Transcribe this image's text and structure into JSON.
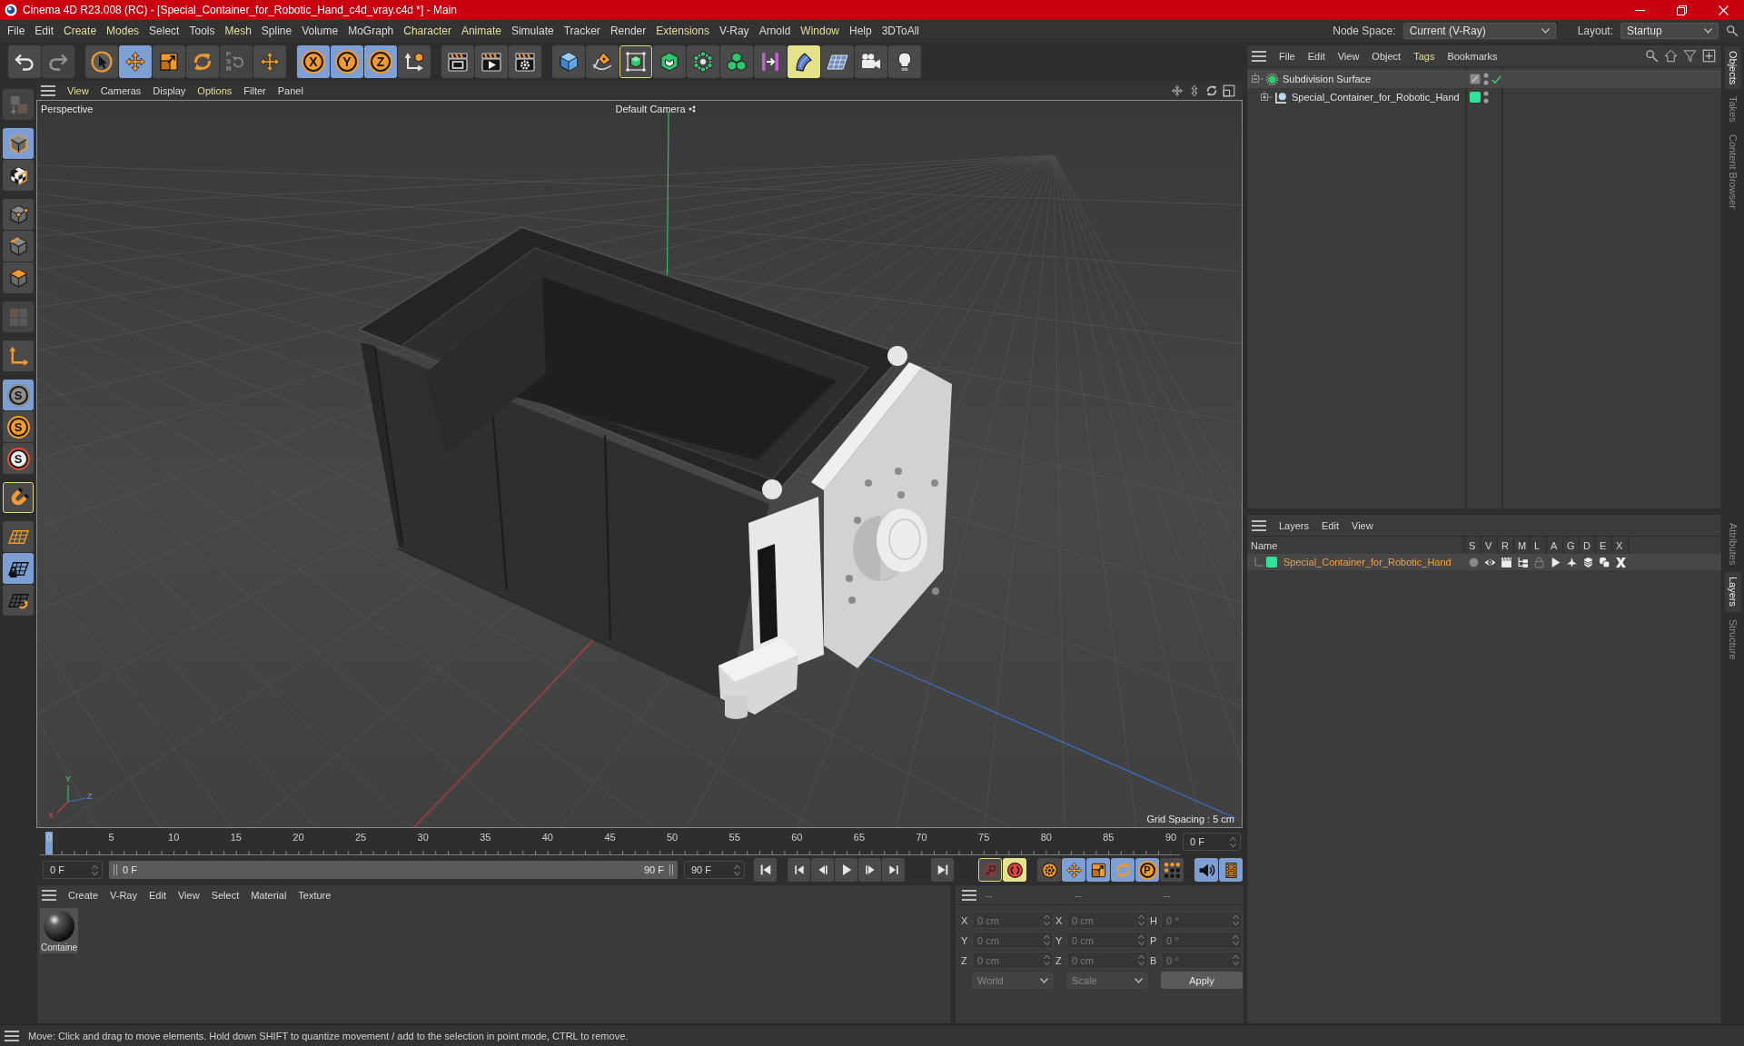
{
  "window": {
    "title": "Cinema 4D R23.008 (RC) - [Special_Container_for_Robotic_Hand_c4d_vray.c4d *] - Main"
  },
  "menu_bar": {
    "items": [
      {
        "label": "File",
        "highlighted": false
      },
      {
        "label": "Edit",
        "highlighted": false
      },
      {
        "label": "Create",
        "highlighted": true
      },
      {
        "label": "Modes",
        "highlighted": true
      },
      {
        "label": "Select",
        "highlighted": false
      },
      {
        "label": "Tools",
        "highlighted": false
      },
      {
        "label": "Mesh",
        "highlighted": true
      },
      {
        "label": "Spline",
        "highlighted": false
      },
      {
        "label": "Volume",
        "highlighted": false
      },
      {
        "label": "MoGraph",
        "highlighted": false
      },
      {
        "label": "Character",
        "highlighted": true
      },
      {
        "label": "Animate",
        "highlighted": true
      },
      {
        "label": "Simulate",
        "highlighted": false
      },
      {
        "label": "Tracker",
        "highlighted": false
      },
      {
        "label": "Render",
        "highlighted": false
      },
      {
        "label": "Extensions",
        "highlighted": true
      },
      {
        "label": "V-Ray",
        "highlighted": false
      },
      {
        "label": "Arnold",
        "highlighted": false
      },
      {
        "label": "Window",
        "highlighted": true
      },
      {
        "label": "Help",
        "highlighted": false
      },
      {
        "label": "3DToAll",
        "highlighted": false
      }
    ],
    "node_space": {
      "label": "Node Space:",
      "value": "Current (V-Ray)"
    },
    "layout": {
      "label": "Layout:",
      "value": "Startup"
    }
  },
  "toolbar": {
    "groups": [
      [
        {
          "kind": "undo",
          "selected": false,
          "disabled": false,
          "outlined": false,
          "lit": false
        },
        {
          "kind": "redo",
          "selected": false,
          "disabled": true,
          "outlined": false,
          "lit": false
        }
      ],
      [
        {
          "kind": "select",
          "selected": false,
          "disabled": false,
          "outlined": false,
          "lit": false
        },
        {
          "kind": "move",
          "selected": true,
          "disabled": false,
          "outlined": false,
          "lit": false
        },
        {
          "kind": "scale",
          "selected": false,
          "disabled": false,
          "outlined": false,
          "lit": false
        },
        {
          "kind": "rotate",
          "selected": false,
          "disabled": false,
          "outlined": false,
          "lit": false
        },
        {
          "kind": "psr",
          "selected": false,
          "disabled": true,
          "outlined": false,
          "lit": false,
          "label": "PSR"
        },
        {
          "kind": "axis_move",
          "selected": false,
          "disabled": false,
          "outlined": false,
          "lit": false
        }
      ],
      [
        {
          "kind": "axis_lock",
          "selected": true,
          "disabled": false,
          "outlined": false,
          "lit": false,
          "label": "X"
        },
        {
          "kind": "axis_lock",
          "selected": true,
          "disabled": false,
          "outlined": false,
          "lit": false,
          "label": "Y"
        },
        {
          "kind": "axis_lock",
          "selected": true,
          "disabled": false,
          "outlined": false,
          "lit": false,
          "label": "Z"
        },
        {
          "kind": "coordinate_system",
          "selected": false,
          "disabled": false,
          "outlined": false,
          "lit": false
        }
      ],
      [
        {
          "kind": "render_view",
          "selected": false,
          "disabled": false,
          "outlined": false,
          "lit": false
        },
        {
          "kind": "render_picture",
          "selected": false,
          "disabled": false,
          "outlined": false,
          "lit": false
        },
        {
          "kind": "render_settings",
          "selected": false,
          "disabled": false,
          "outlined": false,
          "lit": false
        }
      ],
      [
        {
          "kind": "cube",
          "selected": false,
          "disabled": false,
          "outlined": false,
          "lit": false
        },
        {
          "kind": "pen",
          "selected": false,
          "disabled": false,
          "outlined": false,
          "lit": false
        },
        {
          "kind": "cube_cage",
          "selected": false,
          "disabled": false,
          "outlined": true,
          "lit": false
        },
        {
          "kind": "cube_outline",
          "selected": false,
          "disabled": false,
          "outlined": false,
          "lit": false
        },
        {
          "kind": "node_sphere",
          "selected": false,
          "disabled": false,
          "outlined": false,
          "lit": false
        },
        {
          "kind": "stacked_cubes",
          "selected": false,
          "disabled": false,
          "outlined": false,
          "lit": false
        },
        {
          "kind": "bracket",
          "selected": false,
          "disabled": false,
          "outlined": false,
          "lit": false
        },
        {
          "kind": "bend",
          "selected": false,
          "disabled": false,
          "outlined": false,
          "lit": true
        },
        {
          "kind": "floor",
          "selected": false,
          "disabled": false,
          "outlined": false,
          "lit": false
        },
        {
          "kind": "camera",
          "selected": false,
          "disabled": false,
          "outlined": false,
          "lit": false
        },
        {
          "kind": "light",
          "selected": false,
          "disabled": false,
          "outlined": false,
          "lit": false
        }
      ]
    ]
  },
  "side_tools": {
    "groups": [
      [
        {
          "kind": "make_editable",
          "selected": false,
          "disabled": true,
          "outlined": false,
          "lit": false
        }
      ],
      [
        {
          "kind": "model_mode",
          "selected": true,
          "disabled": false,
          "outlined": false,
          "lit": false
        },
        {
          "kind": "texture_mode",
          "selected": false,
          "disabled": false,
          "outlined": false,
          "lit": false
        }
      ],
      [
        {
          "kind": "points_mode",
          "selected": false,
          "disabled": false,
          "outlined": false,
          "lit": false
        },
        {
          "kind": "edges_mode",
          "selected": false,
          "disabled": false,
          "outlined": false,
          "lit": false
        },
        {
          "kind": "polygons_mode",
          "selected": false,
          "disabled": false,
          "outlined": false,
          "lit": false
        }
      ],
      [
        {
          "kind": "uv_mode",
          "selected": false,
          "disabled": true,
          "outlined": false,
          "lit": false
        }
      ],
      [
        {
          "kind": "axis_mode",
          "selected": false,
          "disabled": false,
          "outlined": false,
          "lit": false
        }
      ],
      [
        {
          "kind": "snap_grey",
          "selected": true,
          "disabled": false,
          "outlined": false,
          "lit": false,
          "label": "S"
        },
        {
          "kind": "snap_orange",
          "selected": false,
          "disabled": false,
          "outlined": false,
          "lit": false,
          "label": "S"
        },
        {
          "kind": "snap_ring",
          "selected": false,
          "disabled": false,
          "outlined": false,
          "lit": false,
          "label": "S"
        }
      ],
      [
        {
          "kind": "magnet",
          "selected": false,
          "disabled": false,
          "outlined": true,
          "lit": false
        }
      ],
      [
        {
          "kind": "grid_plane",
          "selected": false,
          "disabled": false,
          "outlined": false,
          "lit": false
        },
        {
          "kind": "grid_lock",
          "selected": true,
          "disabled": false,
          "outlined": false,
          "lit": false
        },
        {
          "kind": "grid_rotate",
          "selected": false,
          "disabled": false,
          "outlined": false,
          "lit": false
        }
      ]
    ]
  },
  "viewport": {
    "menu": [
      {
        "label": "View",
        "highlighted": true
      },
      {
        "label": "Cameras",
        "highlighted": false
      },
      {
        "label": "Display",
        "highlighted": false
      },
      {
        "label": "Options",
        "highlighted": true
      },
      {
        "label": "Filter",
        "highlighted": false
      },
      {
        "label": "Panel",
        "highlighted": false
      }
    ],
    "camera": "Perspective",
    "camera_name": "Default Camera",
    "grid_spacing": "Grid Spacing : 5 cm",
    "gizmo": {
      "x": "X",
      "y": "Y",
      "z": "Z"
    }
  },
  "timeline": {
    "ruler": [
      "0",
      "5",
      "10",
      "15",
      "20",
      "25",
      "30",
      "35",
      "40",
      "45",
      "50",
      "55",
      "60",
      "65",
      "70",
      "75",
      "80",
      "85",
      "90"
    ],
    "playhead": {
      "level": 0
    },
    "current_frame": "0 F",
    "start_field": "0 F",
    "range": {
      "start": "0 F",
      "end": "90 F"
    },
    "end_field": "90 F",
    "key_tools": [
      [
        {
          "kind": "autokey",
          "selected": false,
          "outlined": true,
          "lit": false
        },
        {
          "kind": "record",
          "selected": false,
          "outlined": false,
          "lit": true
        }
      ],
      [
        {
          "kind": "key_settings",
          "selected": false,
          "outlined": false,
          "lit": false
        },
        {
          "kind": "move",
          "selected": true,
          "outlined": false,
          "lit": false
        },
        {
          "kind": "scale",
          "selected": true,
          "outlined": false,
          "lit": false
        },
        {
          "kind": "rotate",
          "selected": true,
          "outlined": false,
          "lit": false
        },
        {
          "kind": "param_key",
          "selected": true,
          "outlined": false,
          "lit": false,
          "label": "P"
        },
        {
          "kind": "dot_grid",
          "selected": false,
          "outlined": false,
          "lit": false
        }
      ],
      [
        {
          "kind": "sound",
          "selected": true,
          "outlined": false,
          "lit": false
        },
        {
          "kind": "film",
          "selected": true,
          "outlined": false,
          "lit": false
        }
      ]
    ]
  },
  "material_panel": {
    "menu": [
      {
        "label": "Create",
        "highlighted": false
      },
      {
        "label": "V-Ray",
        "highlighted": false
      },
      {
        "label": "Edit",
        "highlighted": false
      },
      {
        "label": "View",
        "highlighted": false
      },
      {
        "label": "Select",
        "highlighted": false
      },
      {
        "label": "Material",
        "highlighted": false
      },
      {
        "label": "Texture",
        "highlighted": false
      }
    ],
    "materials": [
      {
        "label": "Containe"
      }
    ]
  },
  "coordinates": {
    "disabled": true,
    "headers": [
      "--",
      "--",
      "--"
    ],
    "rows": [
      [
        {
          "axis": "X",
          "value": "0 cm"
        },
        {
          "axis": "X",
          "value": "0 cm"
        },
        {
          "axis": "H",
          "value": "0 °"
        }
      ],
      [
        {
          "axis": "Y",
          "value": "0 cm"
        },
        {
          "axis": "Y",
          "value": "0 cm"
        },
        {
          "axis": "P",
          "value": "0 °"
        }
      ],
      [
        {
          "axis": "Z",
          "value": "0 cm"
        },
        {
          "axis": "Z",
          "value": "0 cm"
        },
        {
          "axis": "B",
          "value": "0 °"
        }
      ]
    ],
    "dropdowns": [
      "World",
      "Scale"
    ],
    "apply": "Apply"
  },
  "objects_panel": {
    "menu": [
      {
        "label": "File",
        "highlighted": false
      },
      {
        "label": "Edit",
        "highlighted": false
      },
      {
        "label": "View",
        "highlighted": false
      },
      {
        "label": "Object",
        "highlighted": false
      },
      {
        "label": "Tags",
        "highlighted": true
      },
      {
        "label": "Bookmarks",
        "highlighted": false
      }
    ],
    "tree": [
      {
        "name": "Subdivision Surface",
        "kind": "subdivision",
        "expanded": true,
        "enabled": true,
        "highlighted": true,
        "children": [
          {
            "name": "Special_Container_for_Robotic_Hand",
            "kind": "polygon",
            "expanded": false,
            "color": "#2fe39b",
            "highlighted": false
          }
        ]
      }
    ]
  },
  "layers_panel": {
    "menu": [
      {
        "label": "Layers",
        "highlighted": false
      },
      {
        "label": "Edit",
        "highlighted": false
      },
      {
        "label": "View",
        "highlighted": false
      }
    ],
    "columns": [
      "Name",
      "S",
      "V",
      "R",
      "M",
      "L",
      "A",
      "G",
      "D",
      "E",
      "X"
    ],
    "rows": [
      {
        "name": "Special_Container_for_Robotic_Hand",
        "color": "#2fe39b",
        "selected": true,
        "toggles": [
          {
            "kind": "solo",
            "on": false
          },
          {
            "kind": "view",
            "on": true
          },
          {
            "kind": "render",
            "on": true
          },
          {
            "kind": "manager",
            "on": true
          },
          {
            "kind": "locked",
            "on": false
          },
          {
            "kind": "animation",
            "on": true
          },
          {
            "kind": "generators",
            "on": true
          },
          {
            "kind": "deformers",
            "on": true
          },
          {
            "kind": "expressions",
            "on": true
          },
          {
            "kind": "xrefs",
            "on": true
          }
        ]
      }
    ]
  },
  "side_tabs": {
    "top": [
      {
        "label": "Objects",
        "selected": true
      },
      {
        "label": "Takes",
        "selected": false
      },
      {
        "label": "Content Browser",
        "selected": false
      }
    ],
    "bottom": [
      {
        "label": "Attributes",
        "selected": false
      },
      {
        "label": "Layers",
        "selected": true
      },
      {
        "label": "Structure",
        "selected": false
      }
    ]
  },
  "status_bar": {
    "text": "Move: Click and drag to move elements. Hold down SHIFT to quantize movement / add to the selection in point mode, CTRL to remove."
  }
}
